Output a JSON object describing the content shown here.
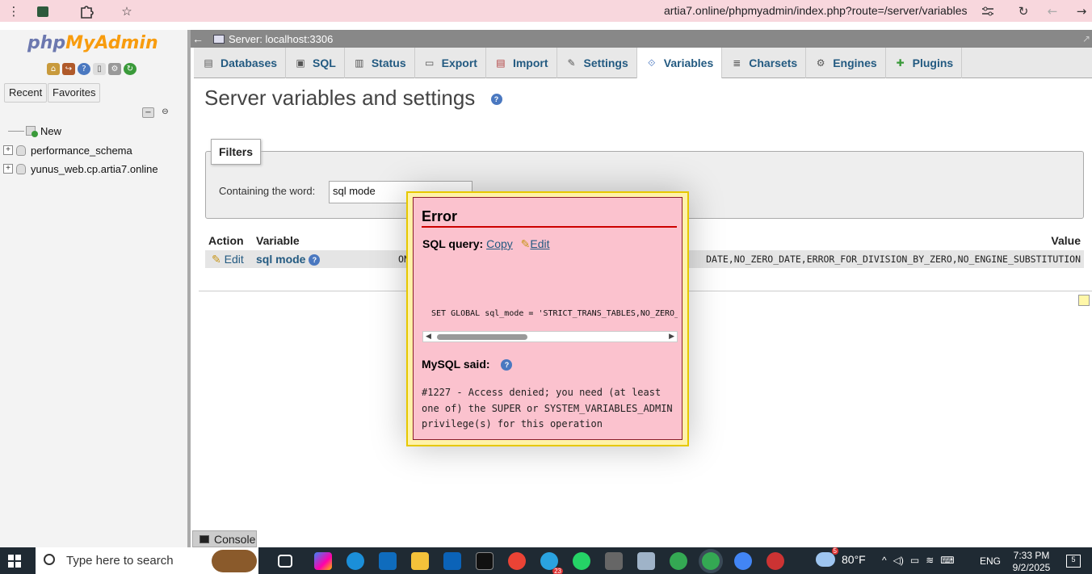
{
  "browser": {
    "url": "artia7.online/phpmyadmin/index.php?route=/server/variables"
  },
  "nav": {
    "logo_php": "php",
    "logo_myadmin": "MyAdmin",
    "tab_recent": "Recent",
    "tab_favorites": "Favorites",
    "tree": [
      {
        "label": "New"
      },
      {
        "label": "performance_schema"
      },
      {
        "label": "yunus_web.cp.artia7.online"
      }
    ]
  },
  "server_bar": {
    "label": "Server: localhost:3306"
  },
  "tabs": [
    {
      "label": "Databases",
      "icon": "database-icon"
    },
    {
      "label": "SQL",
      "icon": "sql-icon"
    },
    {
      "label": "Status",
      "icon": "status-icon"
    },
    {
      "label": "Export",
      "icon": "export-icon"
    },
    {
      "label": "Import",
      "icon": "import-icon"
    },
    {
      "label": "Settings",
      "icon": "wrench-icon"
    },
    {
      "label": "Variables",
      "icon": "variables-icon",
      "active": true
    },
    {
      "label": "Charsets",
      "icon": "charsets-icon"
    },
    {
      "label": "Engines",
      "icon": "engines-icon"
    },
    {
      "label": "Plugins",
      "icon": "plugin-icon"
    }
  ],
  "page": {
    "title": "Server variables and settings"
  },
  "filters": {
    "legend": "Filters",
    "label": "Containing the word:",
    "value": "sql mode"
  },
  "table": {
    "col_action": "Action",
    "col_variable": "Variable",
    "col_value": "Value",
    "row": {
      "action": "Edit",
      "variable": "sql mode",
      "value_left": "ON",
      "value_visible": "DATE,NO_ZERO_DATE,ERROR_FOR_DIVISION_BY_ZERO,NO_ENGINE_SUBSTITUTION"
    }
  },
  "console": {
    "label": "Console"
  },
  "error": {
    "title": "Error",
    "sql_query_label": "SQL query:",
    "copy_link": "Copy",
    "edit_link": "Edit",
    "sql": "SET GLOBAL sql_mode = 'STRICT_TRANS_TABLES,NO_ZERO_DATE,NO_ZERO_IN_DATE,ERROR_FOR_DIVISION_BY_ZERO,NO_ENGINE_SUBSTITUTION';",
    "mysql_said": "MySQL said:",
    "message": "#1227 - Access denied; you need (at least one of) the SUPER or SYSTEM_VARIABLES_ADMIN privilege(s) for this operation"
  },
  "taskbar": {
    "search_placeholder": "Type here to search",
    "weather": "80°F",
    "lang": "ENG",
    "time": "7:33 PM",
    "date": "9/2/2025",
    "notif_count": "5",
    "telegram_badge": "23",
    "weather_badge": "5"
  }
}
